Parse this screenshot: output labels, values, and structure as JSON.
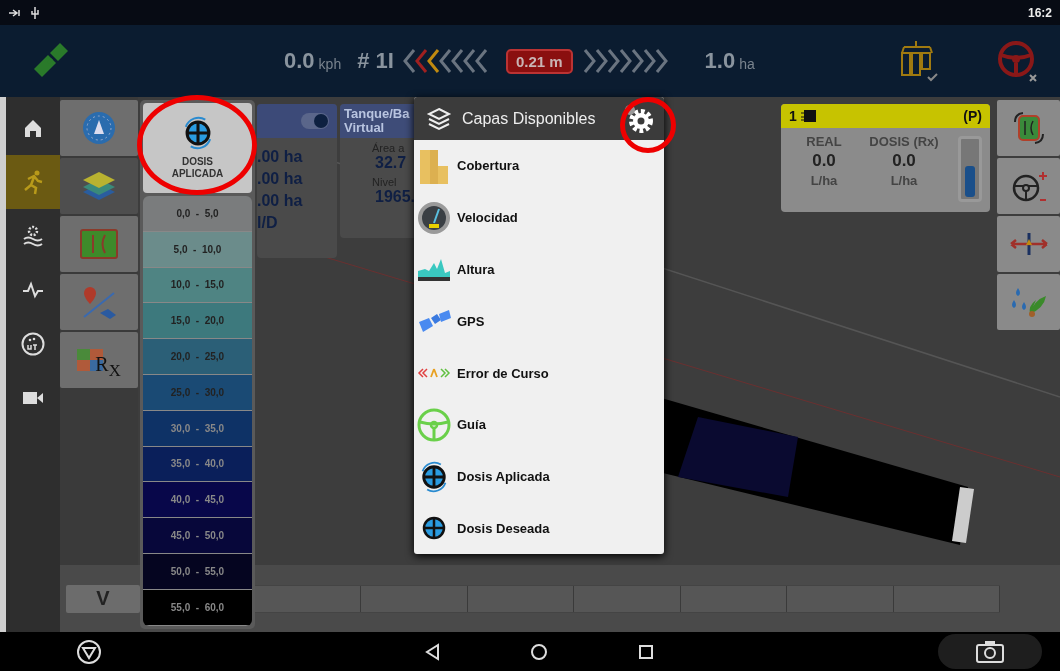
{
  "status_bar": {
    "time": "16:2"
  },
  "top_bar": {
    "speed": "0.0",
    "speed_unit": "kph",
    "line": "# 1I",
    "offset": "0.21 m",
    "area": "1.0",
    "area_unit": "ha"
  },
  "left_nav": {
    "items": [
      {
        "selected": false
      },
      {
        "selected": true
      },
      {
        "selected": false
      },
      {
        "selected": false
      },
      {
        "selected": false
      },
      {
        "selected": false
      }
    ]
  },
  "tool_column": {
    "items": [
      {
        "selected": false
      },
      {
        "selected": true
      },
      {
        "selected": false
      },
      {
        "selected": false
      },
      {
        "selected": false,
        "label": "R$_{X}$"
      }
    ]
  },
  "legend": {
    "button_label": "DOSIS APLICADA",
    "ranges": [
      {
        "label": "0,0  -  5,0",
        "color": "#7a7c7d"
      },
      {
        "label": "5,0  -  10,0",
        "color": "#6b8c8b"
      },
      {
        "label": "10,0  -  15,0",
        "color": "#4f8483"
      },
      {
        "label": "15,0  -  20,0",
        "color": "#3d797d"
      },
      {
        "label": "20,0  -  25,0",
        "color": "#2b5f77"
      },
      {
        "label": "25,0  -  30,0",
        "color": "#1a4a74"
      },
      {
        "label": "30,0  -  35,0",
        "color": "#0e3266"
      },
      {
        "label": "35,0  -  40,0",
        "color": "#0a1f5a"
      },
      {
        "label": "40,0  -  45,0",
        "color": "#08074a"
      },
      {
        "label": "45,0  -  50,0",
        "color": "#07073a"
      },
      {
        "label": "50,0  -  55,0",
        "color": "#050520"
      },
      {
        "label": "55,0  -  60,0",
        "color": "#000000"
      }
    ]
  },
  "area_card": {
    "toggle": {
      "on": true
    },
    "lines": [
      ".00 ha",
      ".00 ha",
      ".00 ha",
      "l/D"
    ]
  },
  "tank_card": {
    "title": "Tanque/Ba\nVirtual",
    "rows": [
      {
        "label": "Área a",
        "value": "32.7"
      },
      {
        "label": "Nivel",
        "value": "1965."
      }
    ]
  },
  "rate_panel": {
    "section": "1",
    "mode": "(P)",
    "columns": [
      {
        "label": "REAL",
        "value": "0.0",
        "unit": "L/ha"
      },
      {
        "label": "DOSIS (Rx)",
        "value": "0.0",
        "unit": "L/ha"
      }
    ],
    "tank": {
      "level": 0.55
    }
  },
  "right_tools": {
    "items": [
      {
        "selected": false
      },
      {
        "selected": false
      },
      {
        "selected": false
      },
      {
        "selected": false
      }
    ]
  },
  "layers_menu": {
    "title": "Capas Disponibles",
    "items": [
      {
        "label": "Cobertura"
      },
      {
        "label": "Velocidad"
      },
      {
        "label": "Altura"
      },
      {
        "label": "GPS"
      },
      {
        "label": "Error de Curso"
      },
      {
        "label": "Guía"
      },
      {
        "label": "Dosis Aplicada"
      },
      {
        "label": "Dosis Deseada"
      }
    ]
  },
  "ruler": {
    "button_label": "V"
  }
}
